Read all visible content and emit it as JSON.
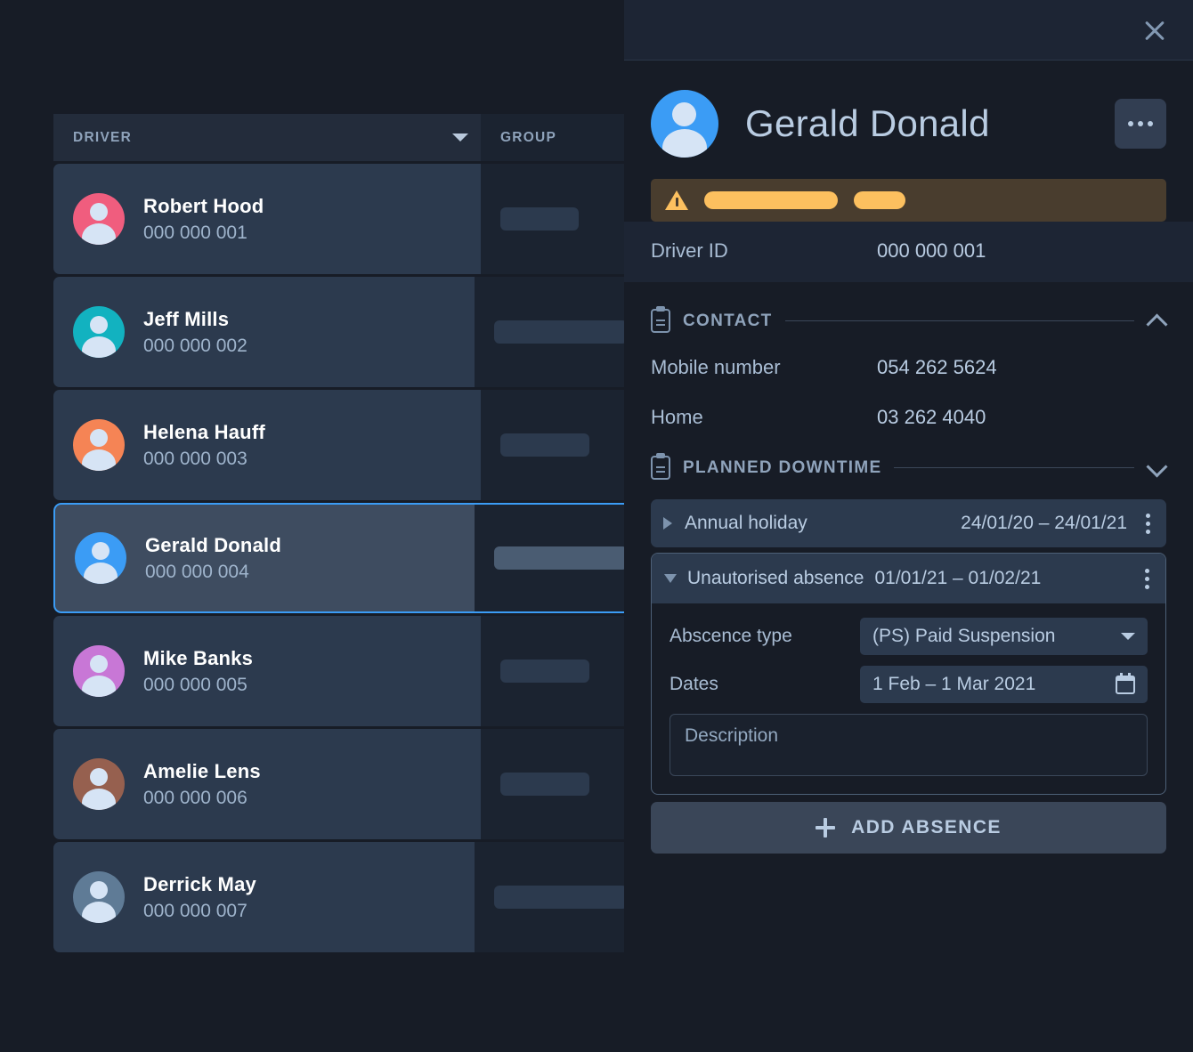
{
  "table": {
    "columns": [
      {
        "key": "driver",
        "label": "DRIVER",
        "sortable": true
      },
      {
        "key": "group",
        "label": "GROUP",
        "sortable": false
      }
    ],
    "rows": [
      {
        "name": "Robert Hood",
        "id": "000 000 001",
        "avatar_color": "#f05d7e",
        "group_pill_width": 88,
        "selected": false
      },
      {
        "name": "Jeff Mills",
        "id": "000 000 002",
        "avatar_color": "#12b2c0",
        "group_pill_width": 150,
        "selected": false
      },
      {
        "name": "Helena Hauff",
        "id": "000 000 003",
        "avatar_color": "#f58455",
        "group_pill_width": 100,
        "selected": false
      },
      {
        "name": "Gerald Donald",
        "id": "000 000 004",
        "avatar_color": "#3b9cf5",
        "group_pill_width": 150,
        "selected": true
      },
      {
        "name": "Mike Banks",
        "id": "000 000 005",
        "avatar_color": "#c877d6",
        "group_pill_width": 100,
        "selected": false
      },
      {
        "name": "Amelie Lens",
        "id": "000 000 006",
        "avatar_color": "#96604f",
        "group_pill_width": 100,
        "selected": false
      },
      {
        "name": "Derrick May",
        "id": "000 000 007",
        "avatar_color": "#5f7b96",
        "group_pill_width": 150,
        "selected": false
      }
    ]
  },
  "panel": {
    "close_label": "×",
    "title": "Gerald Donald",
    "avatar_color": "#3b9cf5",
    "more_label": "•••",
    "warning": {
      "icon": "warning-triangle-icon",
      "pill_widths": [
        150,
        58
      ],
      "bg_color": "#493d2e",
      "pill_color": "#fcc05f"
    },
    "driver_id": {
      "label": "Driver ID",
      "value": "000 000 001"
    },
    "contact": {
      "title": "CONTACT",
      "expanded": true,
      "fields": [
        {
          "label": "Mobile number",
          "value": "054 262 5624"
        },
        {
          "label": "Home",
          "value": "03 262 4040"
        }
      ]
    },
    "planned_downtime": {
      "title": "PLANNED DOWNTIME",
      "expanded": true,
      "entries": [
        {
          "label": "Annual holiday",
          "dates": "24/01/20  –  24/01/21",
          "expanded": false
        },
        {
          "label": "Unautorised absence",
          "dates": "01/01/21  –  01/02/21",
          "expanded": true,
          "form": {
            "type_label": "Abscence type",
            "type_value": "(PS) Paid Suspension",
            "dates_label": "Dates",
            "dates_value": "1 Feb – 1 Mar 2021",
            "description_placeholder": "Description",
            "description_value": ""
          }
        }
      ],
      "add_button_label": "ADD ABSENCE"
    }
  }
}
